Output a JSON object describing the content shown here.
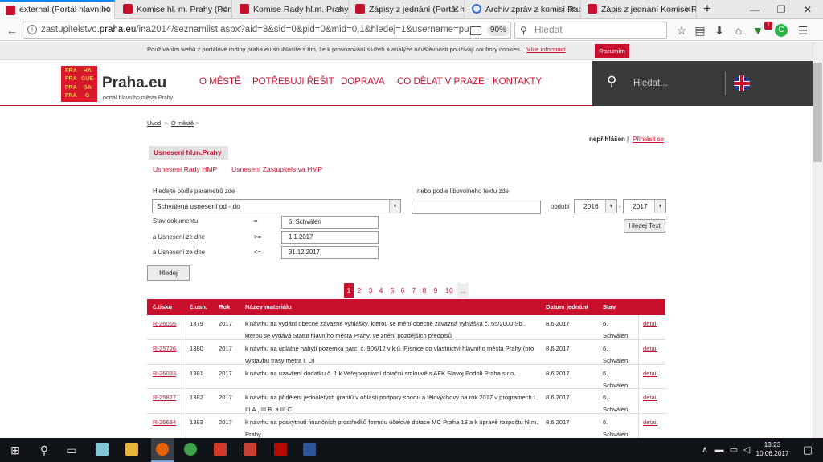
{
  "browser": {
    "tabs": [
      {
        "title": "external (Portál hlavního"
      },
      {
        "title": "Komise hl. m. Prahy (Por"
      },
      {
        "title": "Komise Rady hl.m. Prahy"
      },
      {
        "title": "Zápisy z jednání (Portál h"
      },
      {
        "title": "Archiv zpráv z komisí Rad"
      },
      {
        "title": "Zápis z jednání Komise R"
      }
    ],
    "url_prefix": "zastupitelstvo.",
    "url_domain": "praha.eu",
    "url_rest": "/ina2014/seznamlist.aspx?aid=3&sid=0&pid=0&mid=0,1&hledej=1&username=pu",
    "zoom": "90%",
    "search_placeholder": "Hledat",
    "notification_count": "1"
  },
  "cookie": {
    "text": "Používáním webů z portálové rodiny praha.eu souhlasíte s tím, že k provozování služeb a analýze návštěvnosti používají soubory cookies.",
    "link": "Více informací",
    "button": "Rozumím"
  },
  "site": {
    "logo_words": [
      "PRA",
      "HA",
      "PRA",
      "GUE",
      "PRA",
      "GA",
      "PRA",
      "G"
    ],
    "name": "Praha.eu",
    "subtitle": "portál hlavního města Prahy",
    "menu": [
      "O MĚSTĚ",
      "POTŘEBUJI ŘEŠIT",
      "DOPRAVA",
      "CO DĚLAT V PRAZE",
      "KONTAKTY"
    ],
    "search_placeholder": "Hledat..."
  },
  "breadcrumb": [
    "Úvod",
    "O městě"
  ],
  "login": {
    "status": "nepřihlášen",
    "separator": "|",
    "link": "Přihlásit se"
  },
  "tabs": {
    "active": "Usnesení hl.m.Prahy",
    "other": [
      "Usnesení Rady HMP",
      "Usnesení Zastupitelstva HMP"
    ]
  },
  "form": {
    "param_label": "Hledejte podle parametrů zde",
    "param_value": "Schválená usnesení od - do",
    "text_label": "nebo podle libovolného textu zde",
    "period_label": "období",
    "year_from": "2016",
    "year_dash": "-",
    "year_to": "2017",
    "text_button": "Hledej Text",
    "rows": [
      {
        "label": "Stav dokumentu",
        "op": "=",
        "value": "6. Schválen"
      },
      {
        "label": "a Usnesení ze dne",
        "op": ">=",
        "value": "1.1.2017"
      },
      {
        "label": "a Usnesení ze dne",
        "op": "<=",
        "value": "31.12.2017"
      }
    ],
    "search_button": "Hledej"
  },
  "pagination": [
    "1",
    "2",
    "3",
    "4",
    "5",
    "6",
    "7",
    "8",
    "9",
    "10",
    "..."
  ],
  "table": {
    "headers": [
      "č.tisku",
      "č.usn.",
      "Rok",
      "Název materiálu",
      "Datum jednání",
      "Stav"
    ],
    "rows": [
      {
        "tisk": "R-26065",
        "usn": "1379",
        "rok": "2017",
        "nazev": "k návrhu na vydání obecně závazné vyhlášky, kterou se mění obecně závazná vyhláška č. 55/2000 Sb., kterou se vydává Statut hlavního města Prahy, ve znění pozdějších předpisů",
        "datum": "8.6.2017",
        "stav": "6. Schválen",
        "detail": "detail"
      },
      {
        "tisk": "R-25726",
        "usn": "1380",
        "rok": "2017",
        "nazev": "k návrhu na úplatné nabytí pozemku parc. č. 906/12 v k.ú. Písnice do vlastnictví hlavního města Prahy (pro výstavbu trasy metra I. D)",
        "datum": "8.6.2017",
        "stav": "6. Schválen",
        "detail": "detail"
      },
      {
        "tisk": "R-26033",
        "usn": "1381",
        "rok": "2017",
        "nazev": "k návrhu na uzavření dodatku č. 1 k Veřejnoprávní dotační smlouvě s AFK Slavoj Podolí Praha s.r.o.",
        "datum": "8.6.2017",
        "stav": "6. Schválen",
        "detail": "detail"
      },
      {
        "tisk": "R-25827",
        "usn": "1382",
        "rok": "2017",
        "nazev": "k návrhu na přidělení jednoletých grantů v oblasti podpory sportu a tělovýchovy na rok 2017 v programech I., III.A., III.B. a III.C.",
        "datum": "8.6.2017",
        "stav": "6. Schválen",
        "detail": "detail"
      },
      {
        "tisk": "R-25694",
        "usn": "1383",
        "rok": "2017",
        "nazev": "k návrhu na poskytnutí finančních prostředků formou účelové dotace MČ Praha 13 a k úpravě rozpočtu hl.m. Prahy",
        "datum": "8.6.2017",
        "stav": "6. Schválen",
        "detail": "detail"
      }
    ]
  },
  "taskbar": {
    "time": "13:23",
    "date": "10.06.2017"
  },
  "colors": {
    "accent": "#c8102e",
    "dark_panel": "#3a3a3a"
  }
}
